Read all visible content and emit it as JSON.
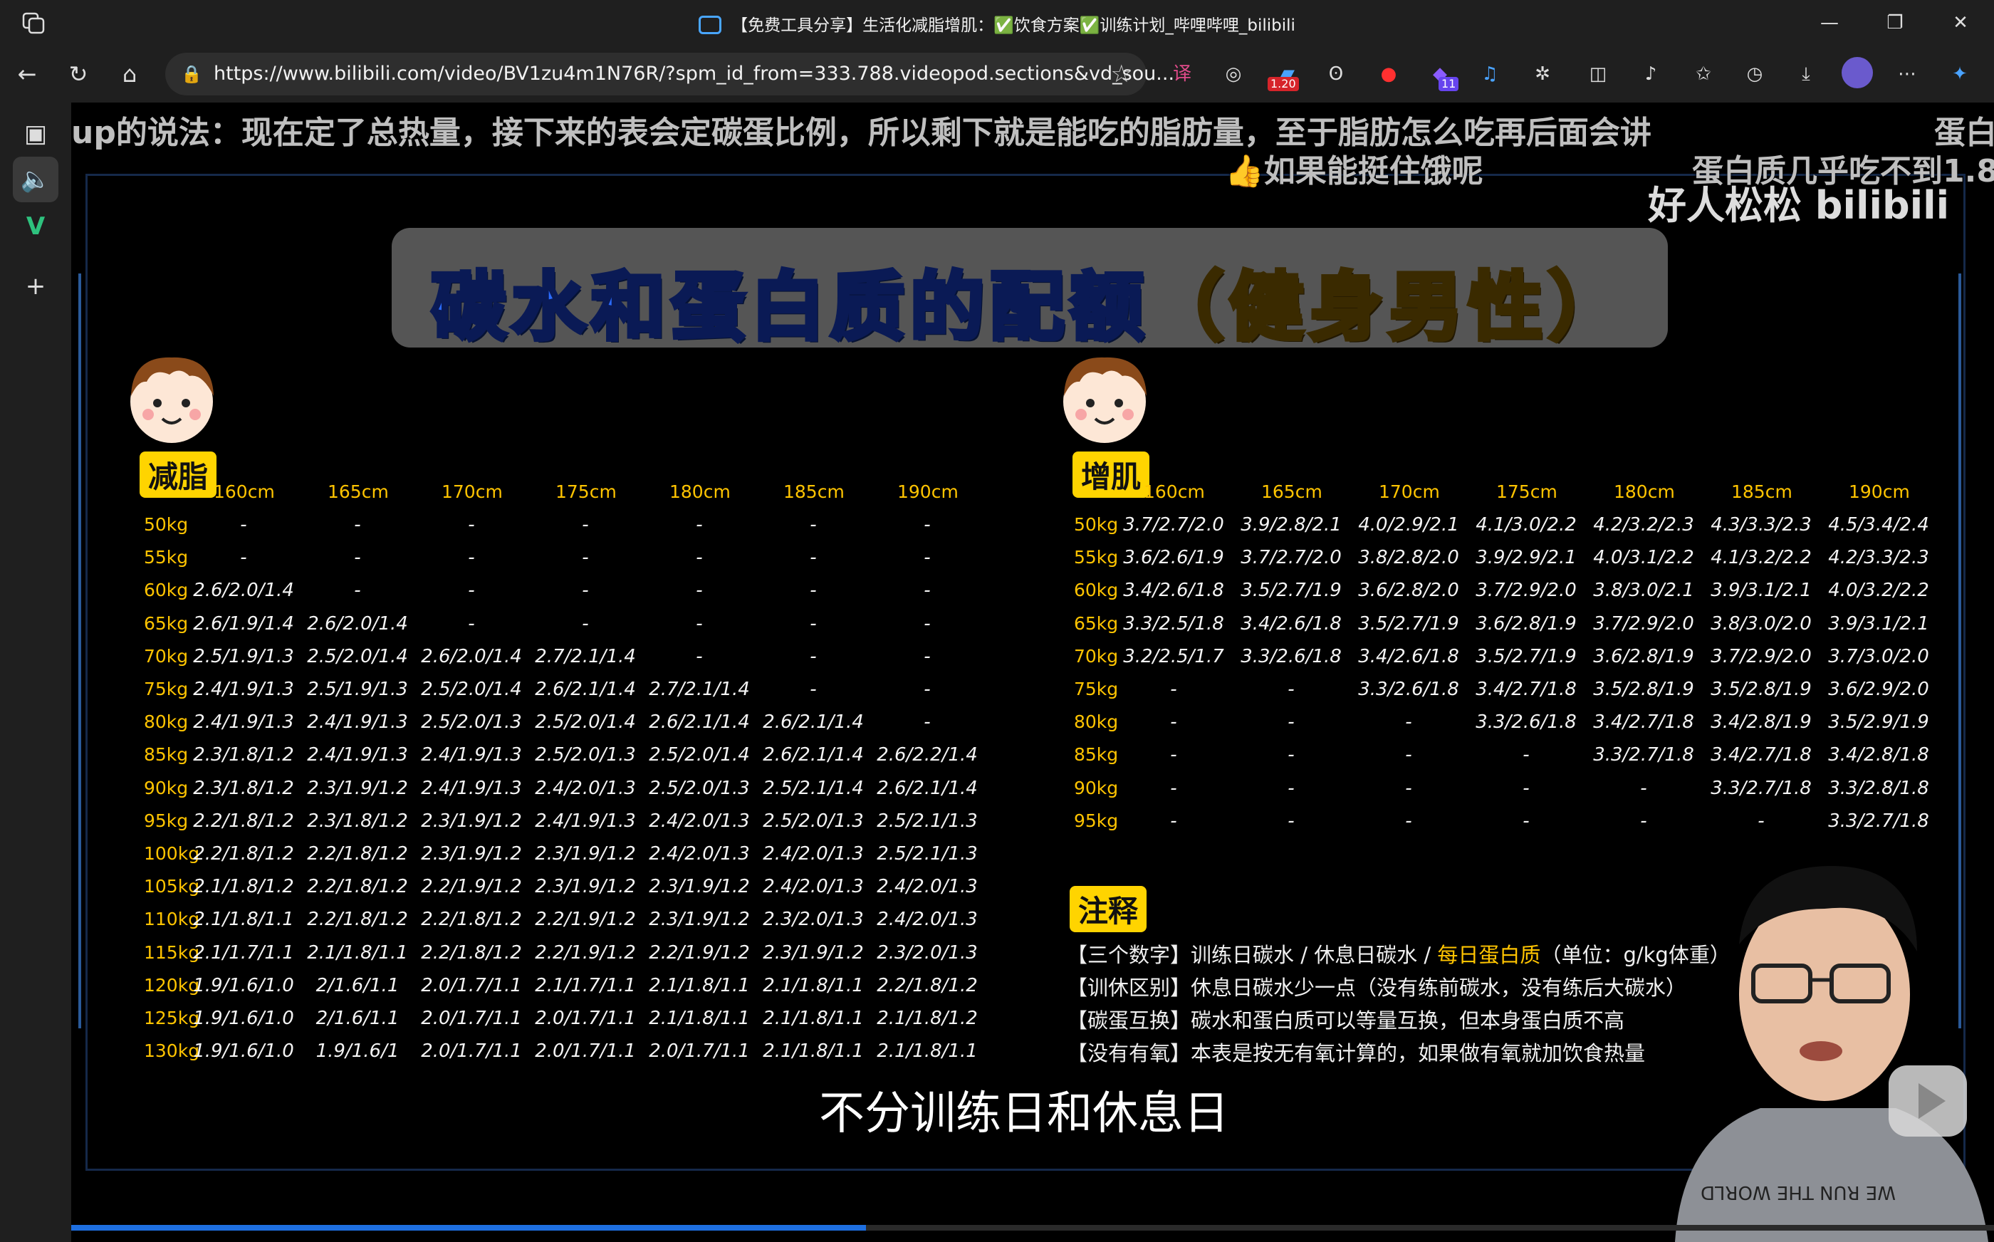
{
  "window": {
    "title_prefix": "【免费工具分享】生活化减脂增肌：",
    "title_diet": "饮食方案",
    "title_plan": "训练计划",
    "title_suffix": "_哔哩哔哩_bilibili",
    "minimize": "—",
    "restore": "❐",
    "close": "✕"
  },
  "address": {
    "url": "https://www.bilibili.com/video/BV1zu4m1N76R/?spm_id_from=333.788.videopod.sections&vd_sou...",
    "ext_badge_1": "1.20",
    "ext_badge_2": "11"
  },
  "danmaku": {
    "line1": "up的说法：现在定了总热量，接下来的表会定碳蛋比例，所以剩下就是能吃的脂肪量，至于脂肪怎么吃再后面会讲",
    "line1_right": "蛋白",
    "line2": "👍如果能挺住饿呢",
    "line2_right": "蛋白质几乎吃不到1.8"
  },
  "watermark": "好人松松 bilibili",
  "banner": {
    "blue": "碳水和蛋白质的配额",
    "yellow": "（健身男性）"
  },
  "cut": {
    "tag": "减脂",
    "heights": [
      "160cm",
      "165cm",
      "170cm",
      "175cm",
      "180cm",
      "185cm",
      "190cm"
    ],
    "weights": [
      "50kg",
      "55kg",
      "60kg",
      "65kg",
      "70kg",
      "75kg",
      "80kg",
      "85kg",
      "90kg",
      "95kg",
      "100kg",
      "105kg",
      "110kg",
      "115kg",
      "120kg",
      "125kg",
      "130kg"
    ],
    "rows": [
      [
        "-",
        "-",
        "-",
        "-",
        "-",
        "-",
        "-"
      ],
      [
        "-",
        "-",
        "-",
        "-",
        "-",
        "-",
        "-"
      ],
      [
        "2.6/2.0/1.4",
        "-",
        "-",
        "-",
        "-",
        "-",
        "-"
      ],
      [
        "2.6/1.9/1.4",
        "2.6/2.0/1.4",
        "-",
        "-",
        "-",
        "-",
        "-"
      ],
      [
        "2.5/1.9/1.3",
        "2.5/2.0/1.4",
        "2.6/2.0/1.4",
        "2.7/2.1/1.4",
        "-",
        "-",
        "-"
      ],
      [
        "2.4/1.9/1.3",
        "2.5/1.9/1.3",
        "2.5/2.0/1.4",
        "2.6/2.1/1.4",
        "2.7/2.1/1.4",
        "-",
        "-"
      ],
      [
        "2.4/1.9/1.3",
        "2.4/1.9/1.3",
        "2.5/2.0/1.3",
        "2.5/2.0/1.4",
        "2.6/2.1/1.4",
        "2.6/2.1/1.4",
        "-"
      ],
      [
        "2.3/1.8/1.2",
        "2.4/1.9/1.3",
        "2.4/1.9/1.3",
        "2.5/2.0/1.3",
        "2.5/2.0/1.4",
        "2.6/2.1/1.4",
        "2.6/2.2/1.4"
      ],
      [
        "2.3/1.8/1.2",
        "2.3/1.9/1.2",
        "2.4/1.9/1.3",
        "2.4/2.0/1.3",
        "2.5/2.0/1.3",
        "2.5/2.1/1.4",
        "2.6/2.1/1.4"
      ],
      [
        "2.2/1.8/1.2",
        "2.3/1.8/1.2",
        "2.3/1.9/1.2",
        "2.4/1.9/1.3",
        "2.4/2.0/1.3",
        "2.5/2.0/1.3",
        "2.5/2.1/1.3"
      ],
      [
        "2.2/1.8/1.2",
        "2.2/1.8/1.2",
        "2.3/1.9/1.2",
        "2.3/1.9/1.2",
        "2.4/2.0/1.3",
        "2.4/2.0/1.3",
        "2.5/2.1/1.3"
      ],
      [
        "2.1/1.8/1.2",
        "2.2/1.8/1.2",
        "2.2/1.9/1.2",
        "2.3/1.9/1.2",
        "2.3/1.9/1.2",
        "2.4/2.0/1.3",
        "2.4/2.0/1.3"
      ],
      [
        "2.1/1.8/1.1",
        "2.2/1.8/1.2",
        "2.2/1.8/1.2",
        "2.2/1.9/1.2",
        "2.3/1.9/1.2",
        "2.3/2.0/1.3",
        "2.4/2.0/1.3"
      ],
      [
        "2.1/1.7/1.1",
        "2.1/1.8/1.1",
        "2.2/1.8/1.2",
        "2.2/1.9/1.2",
        "2.2/1.9/1.2",
        "2.3/1.9/1.2",
        "2.3/2.0/1.3"
      ],
      [
        "1.9/1.6/1.0",
        "2/1.6/1.1",
        "2.0/1.7/1.1",
        "2.1/1.7/1.1",
        "2.1/1.8/1.1",
        "2.1/1.8/1.1",
        "2.2/1.8/1.2"
      ],
      [
        "1.9/1.6/1.0",
        "2/1.6/1.1",
        "2.0/1.7/1.1",
        "2.0/1.7/1.1",
        "2.1/1.8/1.1",
        "2.1/1.8/1.1",
        "2.1/1.8/1.2"
      ],
      [
        "1.9/1.6/1.0",
        "1.9/1.6/1",
        "2.0/1.7/1.1",
        "2.0/1.7/1.1",
        "2.0/1.7/1.1",
        "2.1/1.8/1.1",
        "2.1/1.8/1.1"
      ]
    ]
  },
  "bulk": {
    "tag": "增肌",
    "heights": [
      "160cm",
      "165cm",
      "170cm",
      "175cm",
      "180cm",
      "185cm",
      "190cm"
    ],
    "weights": [
      "50kg",
      "55kg",
      "60kg",
      "65kg",
      "70kg",
      "75kg",
      "80kg",
      "85kg",
      "90kg",
      "95kg"
    ],
    "rows": [
      [
        "3.7/2.7/2.0",
        "3.9/2.8/2.1",
        "4.0/2.9/2.1",
        "4.1/3.0/2.2",
        "4.2/3.2/2.3",
        "4.3/3.3/2.3",
        "4.5/3.4/2.4"
      ],
      [
        "3.6/2.6/1.9",
        "3.7/2.7/2.0",
        "3.8/2.8/2.0",
        "3.9/2.9/2.1",
        "4.0/3.1/2.2",
        "4.1/3.2/2.2",
        "4.2/3.3/2.3"
      ],
      [
        "3.4/2.6/1.8",
        "3.5/2.7/1.9",
        "3.6/2.8/2.0",
        "3.7/2.9/2.0",
        "3.8/3.0/2.1",
        "3.9/3.1/2.1",
        "4.0/3.2/2.2"
      ],
      [
        "3.3/2.5/1.8",
        "3.4/2.6/1.8",
        "3.5/2.7/1.9",
        "3.6/2.8/1.9",
        "3.7/2.9/2.0",
        "3.8/3.0/2.0",
        "3.9/3.1/2.1"
      ],
      [
        "3.2/2.5/1.7",
        "3.3/2.6/1.8",
        "3.4/2.6/1.8",
        "3.5/2.7/1.9",
        "3.6/2.8/1.9",
        "3.7/2.9/2.0",
        "3.7/3.0/2.0"
      ],
      [
        "-",
        "-",
        "3.3/2.6/1.8",
        "3.4/2.7/1.8",
        "3.5/2.8/1.9",
        "3.5/2.8/1.9",
        "3.6/2.9/2.0"
      ],
      [
        "-",
        "-",
        "-",
        "3.3/2.6/1.8",
        "3.4/2.7/1.8",
        "3.4/2.8/1.9",
        "3.5/2.9/1.9"
      ],
      [
        "-",
        "-",
        "-",
        "-",
        "3.3/2.7/1.8",
        "3.4/2.7/1.8",
        "3.4/2.8/1.8"
      ],
      [
        "-",
        "-",
        "-",
        "-",
        "-",
        "3.3/2.7/1.8",
        "3.3/2.8/1.8"
      ],
      [
        "-",
        "-",
        "-",
        "-",
        "-",
        "-",
        "3.3/2.7/1.8"
      ]
    ]
  },
  "notes": {
    "tag": "注释",
    "line1a": "【三个数字】训练日碳水 / 休息日碳水 / ",
    "line1b": "每日蛋白质",
    "line1c": "（单位：g/kg体重）",
    "line2": "【训休区别】休息日碳水少一点（没有练前碳水，没有练后大碳水）",
    "line3": "【碳蛋互换】碳水和蛋白质可以等量互换，但本身蛋白质不高",
    "line4": "【没有有氧】本表是按无有氧计算的，如果做有氧就加饮食热量"
  },
  "subtitle": "不分训练日和休息日",
  "presenter_shirt": "WE RUN THE WORLD",
  "colors": {
    "accent": "#ffc400",
    "banner_blue": "#2b6cff",
    "progress": "#1e6fe0"
  }
}
